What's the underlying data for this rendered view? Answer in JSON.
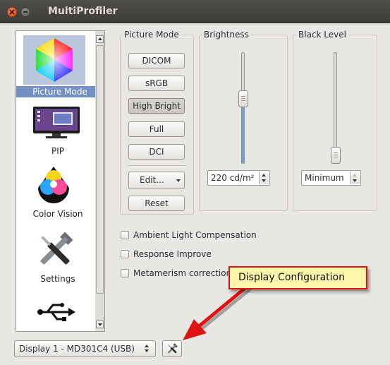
{
  "window": {
    "title": "MultiProfiler"
  },
  "sidebar": {
    "items": [
      {
        "label": "Picture Mode",
        "icon": "color-hexagon-icon",
        "selected": true
      },
      {
        "label": "PIP",
        "icon": "monitor-icon",
        "selected": false
      },
      {
        "label": "Color Vision",
        "icon": "color-vision-icon",
        "selected": false
      },
      {
        "label": "Settings",
        "icon": "tools-icon",
        "selected": false
      },
      {
        "label": "",
        "icon": "usb-icon",
        "selected": false
      }
    ]
  },
  "picture_mode": {
    "title": "Picture Mode",
    "buttons": [
      {
        "label": "DICOM",
        "active": false
      },
      {
        "label": "sRGB",
        "active": false
      },
      {
        "label": "High Bright",
        "active": true
      },
      {
        "label": "Full",
        "active": false
      },
      {
        "label": "DCI",
        "active": false
      }
    ],
    "edit_label": "Edit...",
    "reset_label": "Reset"
  },
  "brightness": {
    "title": "Brightness",
    "value": "220 cd/m²",
    "level": 0.6
  },
  "black_level": {
    "title": "Black Level",
    "value": "Minimum",
    "level": 0.0
  },
  "options": [
    {
      "label": "Ambient Light Compensation",
      "checked": false
    },
    {
      "label": "Response Improve",
      "checked": false
    },
    {
      "label": "Metamerism correction",
      "checked": false
    }
  ],
  "tooltip": {
    "text": "Display Configuration"
  },
  "footer": {
    "display_select": "Display 1 - MD301C4 (USB)",
    "tools_icon": "tools-icon"
  },
  "colors": {
    "titlebar": "#3c3b37",
    "selection": "#7390c2",
    "slider_fill": "#6a9fd4",
    "tooltip_bg": "#fdf5a9",
    "tooltip_border": "#e01313"
  }
}
